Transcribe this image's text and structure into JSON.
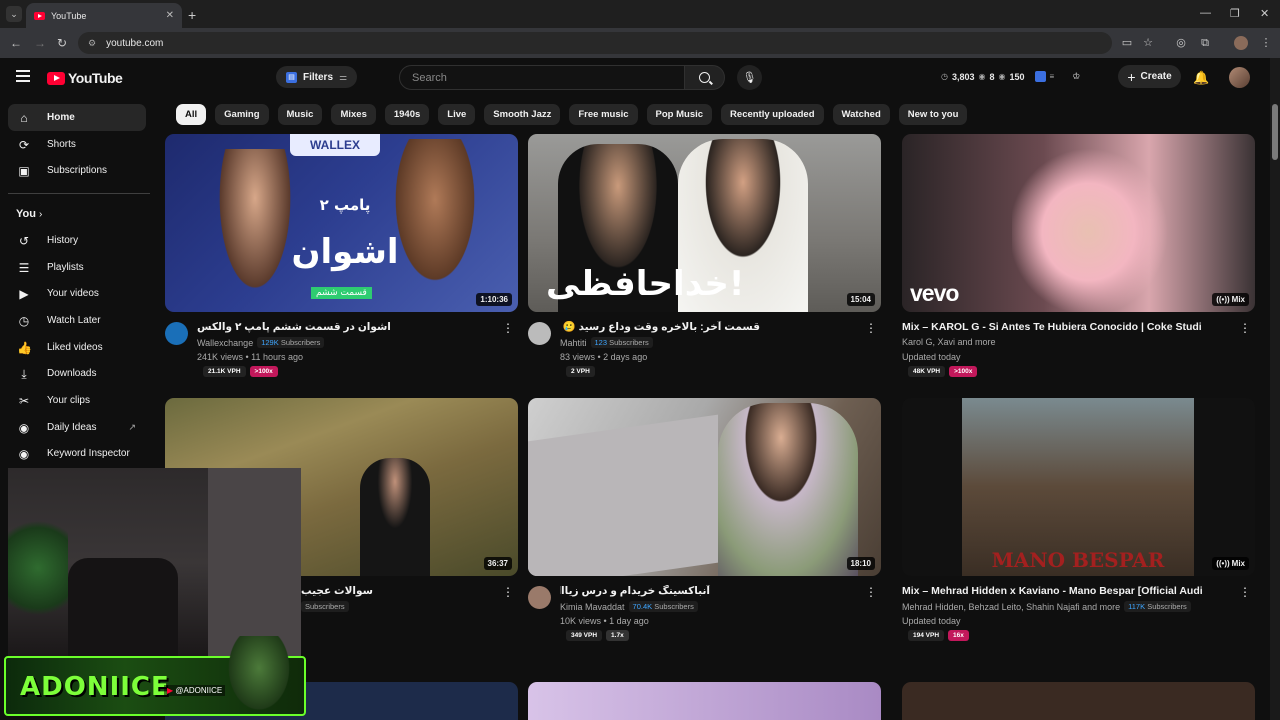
{
  "browser": {
    "tab_title": "YouTube",
    "url": "youtube.com"
  },
  "header": {
    "logo": "YouTube",
    "filters_label": "Filters",
    "search_placeholder": "Search",
    "stats": [
      "3,803",
      "8",
      "150"
    ],
    "create_label": "Create"
  },
  "sidebar": {
    "items": [
      {
        "label": "Home",
        "icon": "home-icon"
      },
      {
        "label": "Shorts",
        "icon": "shorts-icon"
      },
      {
        "label": "Subscriptions",
        "icon": "subscriptions-icon"
      }
    ],
    "you_label": "You",
    "you_items": [
      {
        "label": "History",
        "icon": "history-icon"
      },
      {
        "label": "Playlists",
        "icon": "playlists-icon"
      },
      {
        "label": "Your videos",
        "icon": "your-videos-icon"
      },
      {
        "label": "Watch Later",
        "icon": "watch-later-icon"
      },
      {
        "label": "Liked videos",
        "icon": "liked-icon"
      },
      {
        "label": "Downloads",
        "icon": "downloads-icon"
      },
      {
        "label": "Your clips",
        "icon": "clips-icon"
      },
      {
        "label": "Daily Ideas",
        "icon": "daily-ideas-icon"
      },
      {
        "label": "Keyword Inspector",
        "icon": "keyword-inspector-icon"
      }
    ]
  },
  "chips": [
    "All",
    "Gaming",
    "Music",
    "Mixes",
    "1940s",
    "Live",
    "Smooth Jazz",
    "Free music",
    "Pop Music",
    "Recently uploaded",
    "Watched",
    "New to you"
  ],
  "videos": [
    {
      "title": "اشوان در قسمت ششم پامپ ۲ والکس",
      "channel": "Wallexchange",
      "subs": "129K",
      "subs_label": "Subscribers",
      "views": "241K views • 11 hours ago",
      "duration": "1:10:36",
      "vph": "21.1K VPH",
      "mult": ">100x",
      "mult_color": "#c2185b"
    },
    {
      "title": "قسمت آخر: بالاخره وقت وداع رسید 🥲 ✈️ 😟",
      "channel": "Mahtiti",
      "subs": "123",
      "subs_label": "Subscribers",
      "views": "83 views • 2 days ago",
      "duration": "15:04",
      "vph": "2 VPH",
      "mult": "",
      "mult_color": ""
    },
    {
      "title": "Mix – KAROL G - Si Antes Te Hubiera Conocido | Coke Studio",
      "channel": "Karol G, Xavi and more",
      "subs": "",
      "subs_label": "",
      "views": "Updated today",
      "duration": "Mix",
      "vph": "48K VPH",
      "mult": ">100x",
      "mult_color": "#c2185b"
    },
    {
      "title": "سوالات عجیب",
      "channel": "",
      "subs": "",
      "subs_label": "Subscribers",
      "views": "",
      "duration": "36:37",
      "vph": "",
      "mult": "",
      "mult_color": ""
    },
    {
      "title": "آنباکسینگ خریدام و درس زیاااادد",
      "channel": "Kimia Mavaddat",
      "subs": "70.4K",
      "subs_label": "Subscribers",
      "views": "10K views • 1 day ago",
      "duration": "18:10",
      "vph": "349 VPH",
      "mult": "1.7x",
      "mult_color": "#333"
    },
    {
      "title": "Mix – Mehrad Hidden x Kaviano - Mano Bespar [Official Audio]",
      "channel": "Mehrad Hidden, Behzad Leito, Shahin Najafi and more",
      "subs": "117K",
      "subs_label": "Subscribers",
      "views": "Updated today",
      "duration": "Mix",
      "vph": "194 VPH",
      "mult": "16x",
      "mult_color": "#c2185b"
    }
  ],
  "thumb_text": {
    "v1_brand": "WALLEX",
    "v1_title": "اشوان",
    "v1_sub": "پامپ ۲",
    "v1_badge": "قسمت ششم",
    "v2_text": "خداحافظی!",
    "v3_vevo": "vevo",
    "v6_text": "MANO BESPAR"
  },
  "overlay": {
    "name": "ADONIICE",
    "handle": "@ADONIICE"
  }
}
